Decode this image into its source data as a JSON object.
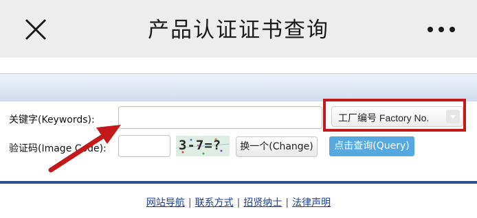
{
  "header": {
    "title": "产品认证证书查询",
    "close_icon": "close-icon",
    "more_icon": "more-dots-icon"
  },
  "form": {
    "keywords_label": "关键字(Keywords):",
    "keywords_value": "",
    "search_type_selected": "工厂编号 Factory No.",
    "image_code_label": "验证码(Image Code):",
    "image_code_value": "",
    "captcha_text": "3-7=?",
    "change_button": "换一个(Change)",
    "query_button": "点击查询(Query)"
  },
  "footer": {
    "links": [
      "网站导航",
      "联系方式",
      "招贤纳士",
      "法律声明"
    ],
    "separator": "|"
  },
  "colors": {
    "highlight_box": "#c4191b",
    "arrow": "#c4191b",
    "query_button": "#56a8e0",
    "divider": "#2f4f94"
  }
}
